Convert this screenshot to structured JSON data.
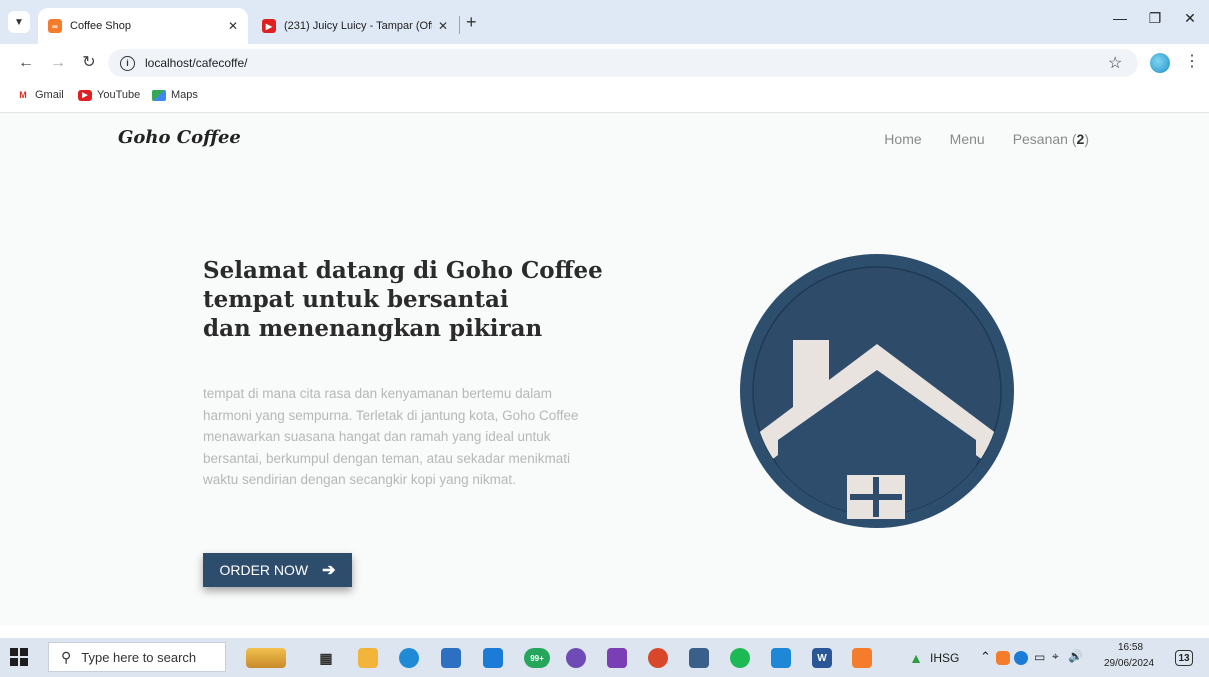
{
  "browser": {
    "tabs": [
      {
        "title": "Coffee Shop",
        "favicon": "xampp-icon",
        "active": true
      },
      {
        "title": "(231) Juicy Luicy - Tampar (Offic",
        "favicon": "youtube-icon",
        "active": false
      }
    ],
    "url": "localhost/cafecoffe/",
    "bookmarks": [
      {
        "label": "Gmail",
        "icon": "gmail-icon"
      },
      {
        "label": "YouTube",
        "icon": "youtube-icon"
      },
      {
        "label": "Maps",
        "icon": "maps-icon"
      }
    ]
  },
  "site": {
    "brand": "Goho Coffee",
    "nav": {
      "home": "Home",
      "menu": "Menu",
      "orders": "Pesanan",
      "orders_count": "2"
    },
    "hero": {
      "headline": [
        "Selamat datang di Goho Coffee",
        "tempat untuk bersantai",
        "dan menenangkan pikiran"
      ],
      "description": "tempat di mana cita rasa dan kenyamanan bertemu dalam harmoni yang sempurna. Terletak di jantung kota, Goho Coffee menawarkan suasana hangat dan ramah yang ideal untuk bersantai, berkumpul dengan teman, atau sekadar menikmati waktu sendirian dengan secangkir kopi yang nikmat.",
      "cta": "ORDER NOW"
    },
    "colors": {
      "accent": "#2e4c6c",
      "house": "#e8e3df",
      "circle": "#2e4e6e"
    }
  },
  "taskbar": {
    "search_placeholder": "Type here to search",
    "badge": "99+",
    "ticker": "IHSG",
    "time": "16:58",
    "date": "29/06/2024",
    "notifications": "13"
  }
}
